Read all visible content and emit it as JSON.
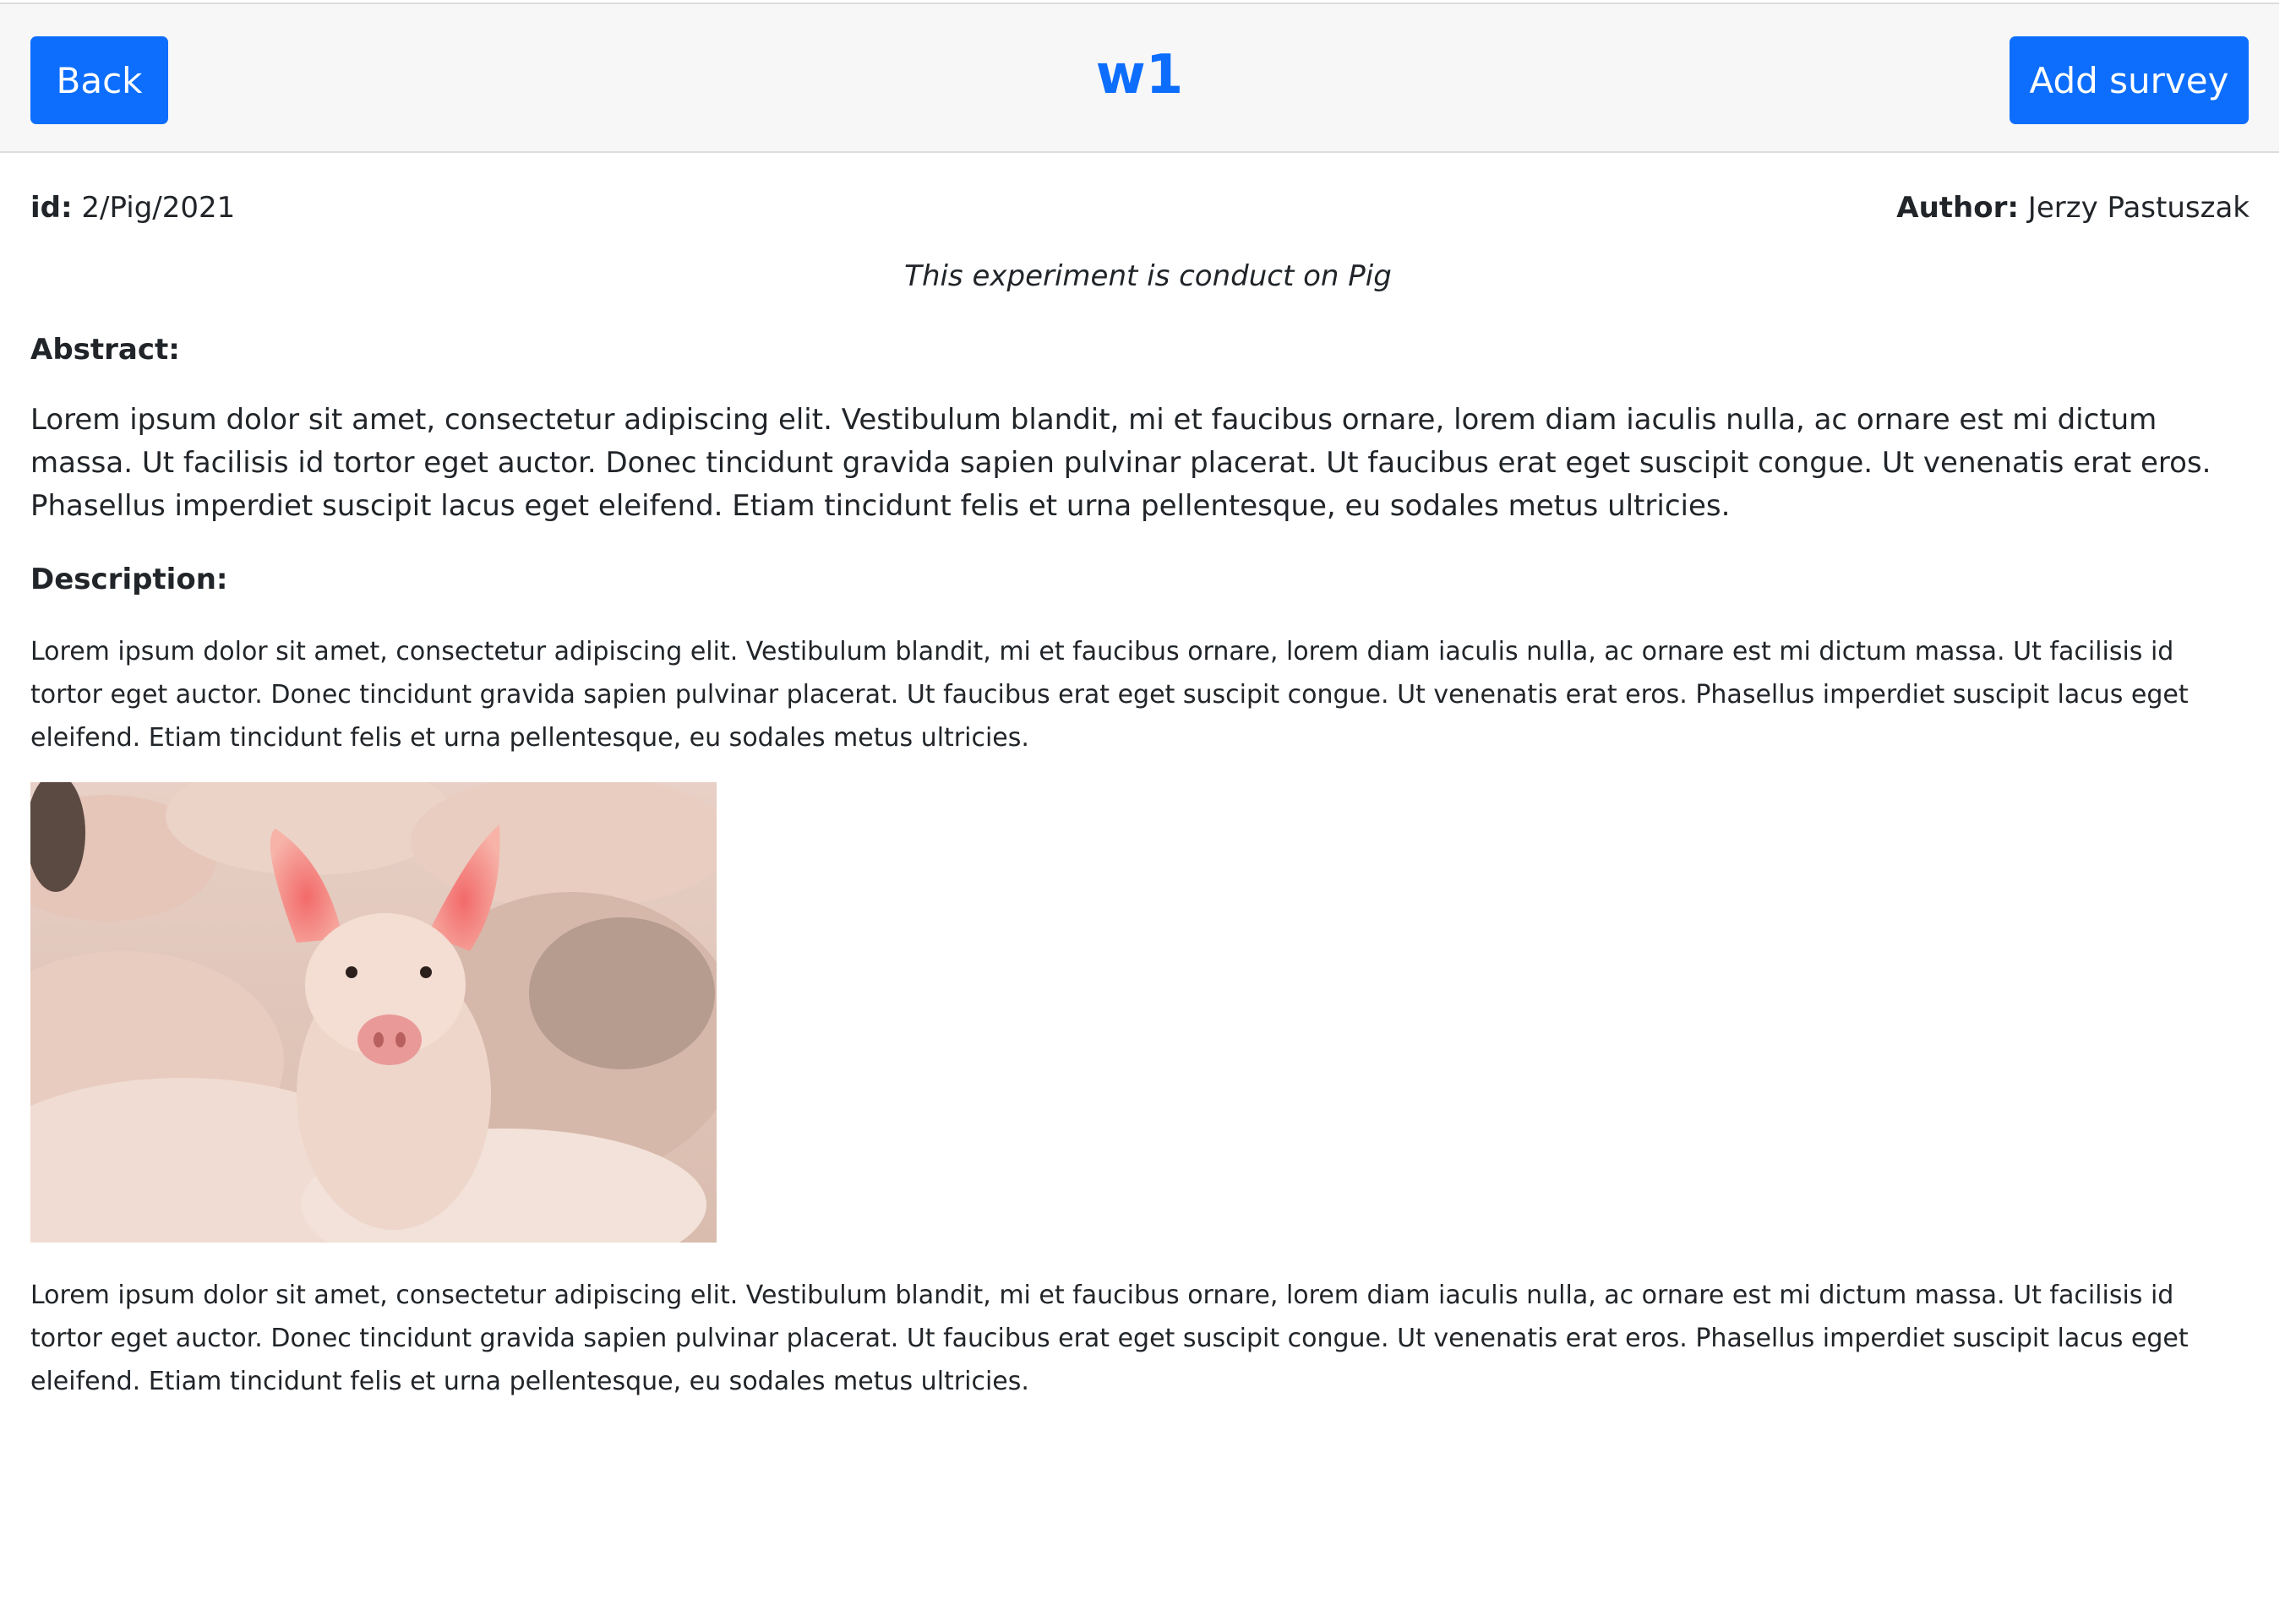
{
  "header": {
    "back_label": "Back",
    "title": "w1",
    "add_survey_label": "Add survey"
  },
  "meta": {
    "id_label": "id:",
    "id_value": "2/Pig/2021",
    "author_label": "Author:",
    "author_value": "Jerzy Pastuszak"
  },
  "subtitle": "This experiment is conduct on Pig",
  "abstract": {
    "heading": "Abstract:",
    "text": "Lorem ipsum dolor sit amet, consectetur adipiscing elit. Vestibulum blandit, mi et faucibus ornare, lorem diam iaculis nulla, ac ornare est mi dictum massa. Ut facilisis id tortor eget auctor. Donec tincidunt gravida sapien pulvinar placerat. Ut faucibus erat eget suscipit congue. Ut venenatis erat eros. Phasellus imperdiet suscipit lacus eget eleifend. Etiam tincidunt felis et urna pellentesque, eu sodales metus ultricies."
  },
  "description": {
    "heading": "Description:",
    "text_before_image": "Lorem ipsum dolor sit amet, consectetur adipiscing elit. Vestibulum blandit, mi et faucibus ornare, lorem diam iaculis nulla, ac ornare est mi dictum massa. Ut facilisis id tortor eget auctor. Donec tincidunt gravida sapien pulvinar placerat. Ut faucibus erat eget suscipit congue. Ut venenatis erat eros. Phasellus imperdiet suscipit lacus eget eleifend. Etiam tincidunt felis et urna pellentesque, eu sodales metus ultricies.",
    "text_after_image": "Lorem ipsum dolor sit amet, consectetur adipiscing elit. Vestibulum blandit, mi et faucibus ornare, lorem diam iaculis nulla, ac ornare est mi dictum massa. Ut facilisis id tortor eget auctor. Donec tincidunt gravida sapien pulvinar placerat. Ut faucibus erat eget suscipit congue. Ut venenatis erat eros. Phasellus imperdiet suscipit lacus eget eleifend. Etiam tincidunt felis et urna pellentesque, eu sodales metus ultricies."
  },
  "colors": {
    "accent": "#0d6efd",
    "header_bg": "#f7f7f7",
    "text": "#212529"
  }
}
